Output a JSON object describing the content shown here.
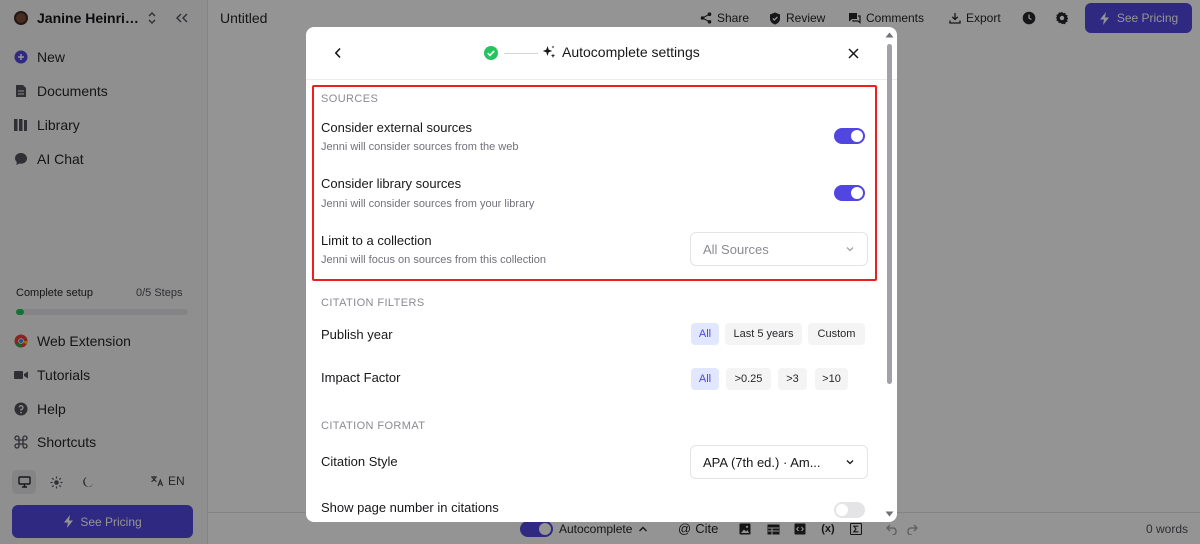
{
  "sidebar": {
    "user_name": "Janine Heinri…",
    "nav": [
      {
        "label": "New",
        "icon": "plus-circle-icon"
      },
      {
        "label": "Documents",
        "icon": "document-icon"
      },
      {
        "label": "Library",
        "icon": "library-icon"
      },
      {
        "label": "AI Chat",
        "icon": "chat-icon"
      }
    ],
    "setup": {
      "label": "Complete setup",
      "steps": "0/5 Steps",
      "progress": 0
    },
    "extras": [
      {
        "label": "Web Extension",
        "icon": "chrome-icon"
      },
      {
        "label": "Tutorials",
        "icon": "video-icon"
      },
      {
        "label": "Help",
        "icon": "help-icon"
      },
      {
        "label": "Shortcuts",
        "icon": "command-icon"
      }
    ],
    "language": "EN",
    "pricing_label": "See Pricing"
  },
  "topbar": {
    "doc_title": "Untitled",
    "share": "Share",
    "review": "Review",
    "comments": "Comments",
    "export": "Export",
    "pricing_label": "See Pricing"
  },
  "footer": {
    "autocomplete": "Autocomplete",
    "cite": "Cite",
    "word_count": "0 words"
  },
  "modal": {
    "title": "Autocomplete settings",
    "sources_label": "SOURCES",
    "external_title": "Consider external sources",
    "external_desc": "Jenni will consider sources from the web",
    "external_on": true,
    "library_title": "Consider library sources",
    "library_desc": "Jenni will consider sources from your library",
    "library_on": true,
    "collection_title": "Limit to a collection",
    "collection_desc": "Jenni will focus on sources from this collection",
    "collection_value": "All Sources",
    "filters_label": "CITATION FILTERS",
    "publish_year_title": "Publish year",
    "publish_year_options": [
      "All",
      "Last 5 years",
      "Custom"
    ],
    "publish_year_selected": "All",
    "impact_title": "Impact Factor",
    "impact_options": [
      "All",
      ">0.25",
      ">3",
      ">10"
    ],
    "impact_selected": "All",
    "format_label": "CITATION FORMAT",
    "style_title": "Citation Style",
    "style_value": "APA (7th ed.) · Am...",
    "page_number_title": "Show page number in citations",
    "page_number_on": false
  },
  "colors": {
    "accent": "#5147e0",
    "highlight": "#ef1d1d",
    "check": "#22c55e"
  }
}
